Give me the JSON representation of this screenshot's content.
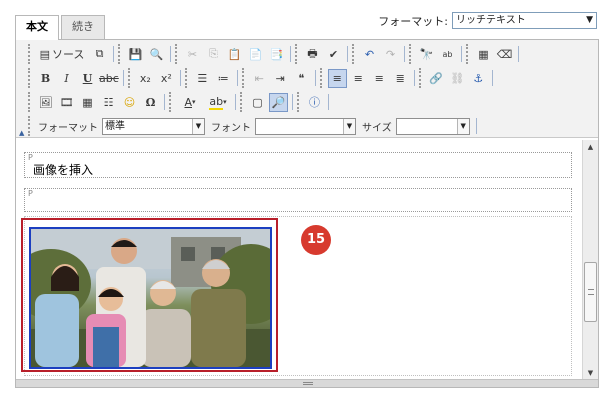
{
  "tabs": [
    {
      "label": "本文",
      "active": true
    },
    {
      "label": "続き",
      "active": false
    }
  ],
  "format_selector": {
    "label": "フォーマット:",
    "value": "リッチテキスト"
  },
  "toolbar": {
    "source_label": "ソース",
    "format_label": "フォーマット",
    "format_value": "標準",
    "font_label": "フォント",
    "font_value": "",
    "size_label": "サイズ",
    "size_value": ""
  },
  "content": {
    "paragraph_tag": "P",
    "paragraph1_text": "画像を挿入",
    "paragraph2_text": "",
    "image_alt": "family photo"
  },
  "annotation": {
    "badge_number": "15",
    "badge_color": "#d73a2e",
    "selection_color": "#b81f2a"
  }
}
